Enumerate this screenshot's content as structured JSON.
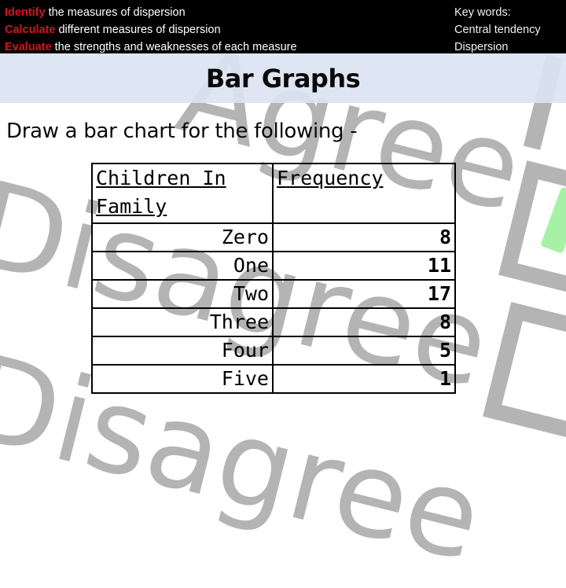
{
  "header": {
    "objectives": [
      {
        "verb": "Identify",
        "text": "the measures of dispersion"
      },
      {
        "verb": "Calculate",
        "text": "different measures of  dispersion"
      },
      {
        "verb": "Evaluate",
        "text": "the strengths and weaknesses of each measure"
      }
    ],
    "keywords": {
      "label": "Key words:",
      "items": [
        "Central tendency",
        "Dispersion"
      ]
    }
  },
  "title": "Bar Graphs",
  "prompt": "Draw a bar chart for the following -",
  "table": {
    "headers": [
      "Children In Family",
      "Frequency"
    ],
    "rows": [
      {
        "category": "Zero",
        "frequency": "8"
      },
      {
        "category": "One",
        "frequency": "11"
      },
      {
        "category": "Two",
        "frequency": "17"
      },
      {
        "category": "Three",
        "frequency": "8"
      },
      {
        "category": "Four",
        "frequency": "5"
      },
      {
        "category": "Five",
        "frequency": "1"
      }
    ]
  },
  "watermark": {
    "words": [
      "Agree",
      "Disagree",
      "Disagree"
    ]
  },
  "colors": {
    "header_bg": "#000000",
    "objective_verb": "#d4141c",
    "title_band": "#dce4f2",
    "watermark": "#b4b4b4",
    "tick": "#90ee90"
  }
}
